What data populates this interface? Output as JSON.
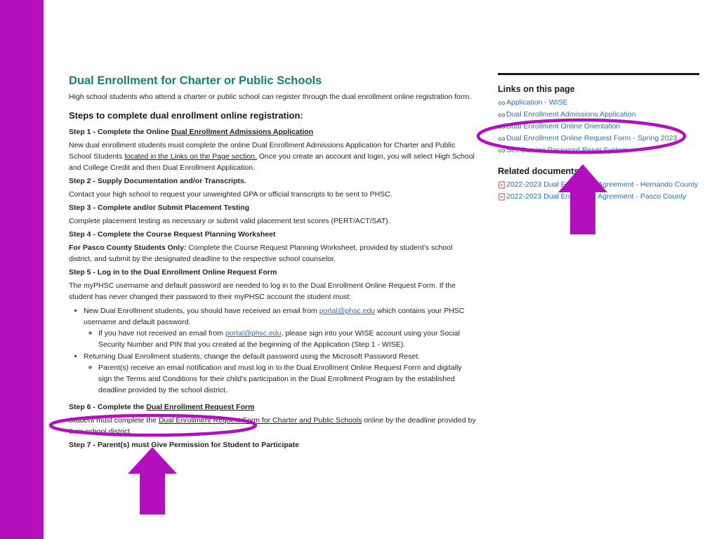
{
  "colors": {
    "accent_bar": "#b40fbf",
    "heading_teal": "#12807a",
    "link_blue": "#2a6db3",
    "annotation": "#b20fbf",
    "pdf_red": "#c8352c"
  },
  "main": {
    "title": "Dual Enrollment for Charter or Public Schools",
    "intro": "High school students who attend a charter or public school can register through the dual enrollment online registration form.",
    "steps_heading": "Steps to complete dual enrollment online registration:",
    "step1": {
      "title_prefix": "Step 1 - Complete the Online ",
      "title_link": "Dual Enrollment Admissions Application",
      "text_a": "New dual enrollment students must complete the online Dual Enrollment Admissions Application for Charter and Public School Students ",
      "text_link": "located in the Links on the Page section.",
      "text_b": " Once you create an account and login, you will select High School and College Credit and then Dual Enrollment Application."
    },
    "step2": {
      "title": "Step 2 - Supply Documentation and/or Transcripts.",
      "text": "Contact your high school to request your unweighted GPA or official transcripts to be sent to PHSC."
    },
    "step3": {
      "title": "Step 3 - Complete and/or Submit Placement Testing",
      "text": "Complete placement testing as necessary or submit valid placement test scores (PERT/ACT/SAT)."
    },
    "step4": {
      "title": "Step 4 - Complete the Course Request Planning Worksheet",
      "text_bold": "For Pasco County Students Only:",
      "text": " Complete the Course Request Planning Worksheet, provided by student's school district, and submit by the designated deadline to the respective school counselor."
    },
    "step5": {
      "title": "Step 5 - Log in to the Dual Enrollment Online Request Form",
      "text": "The myPHSC username and default password are needed to log in to the Dual Enrollment Online Request Form. If the student has never changed their password to their myPHSC account the student must:",
      "b1_a": "New Dual Enrollment students, you should have received an email from ",
      "b1_link": "portal@phsc.edu",
      "b1_b": " which contains your PHSC username and default password.",
      "b1_sub_a": "If you have not received an email from ",
      "b1_sub_link": "portal@phsc.edu",
      "b1_sub_b": ", please sign into your WISE account using your Social Security Number and PIN that you created at the beginning of the Application (Step 1 - WISE).",
      "b2": "Returning Dual Enrollment students, change the default password using the Microsoft Password Reset.",
      "b2_sub": "Parent(s) receive an email notification and must log in to the Dual Enrollment Online Request Form and digitally sign the Terms and Conditions for their child's participation in the Dual Enrollment Program by the established deadline provided by the school district."
    },
    "step6": {
      "title_prefix": "Step 6 - Complete the ",
      "title_link": "Dual Enrollment Request Form",
      "text_a": "Student must complete the ",
      "text_link": "Dual Enrollment Request Form for Charter and Public Schools",
      "text_b": " online by the deadline provided by their school district."
    },
    "step7": {
      "title": "Step 7 - Parent(s) must Give Permission for Student to Participate"
    }
  },
  "sidebar": {
    "links_heading": "Links on this page",
    "links": [
      "Application - WISE",
      "Dual Enrollment Admissions Application",
      "Dual Enrollment Online Orientation",
      "Dual Enrollment Online Request Form - Spring 2023",
      "Self Service Password Reset System"
    ],
    "docs_heading": "Related documents",
    "docs": [
      "2022-2023 Dual Enrollment Agreement - Hernando County",
      "2022-2023 Dual Enrollment Agreement - Pasco County"
    ]
  },
  "icons": {
    "link_icon": "link-icon",
    "pdf_icon": "pdf-icon",
    "arrow": "arrow-up-icon"
  }
}
